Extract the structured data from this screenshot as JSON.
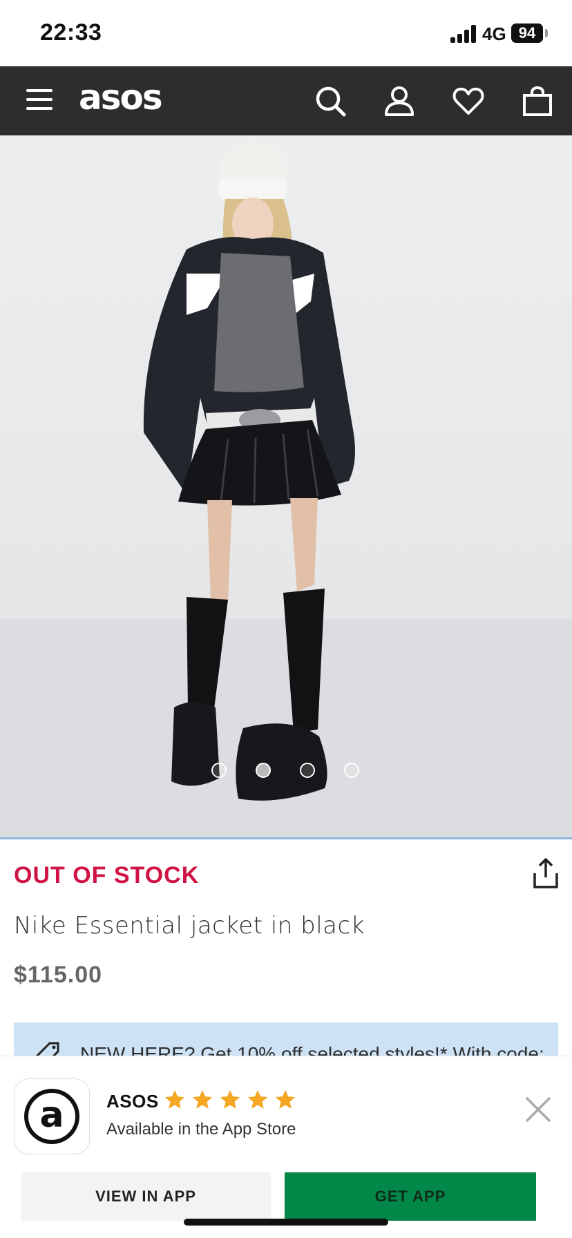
{
  "status_bar": {
    "time": "22:33",
    "network": "4G",
    "battery": "94"
  },
  "header": {
    "logo": "asos",
    "icons": [
      "menu-icon",
      "search-icon",
      "account-icon",
      "heart-icon",
      "bag-icon"
    ]
  },
  "gallery": {
    "image_count": 4,
    "active_index": 1
  },
  "product": {
    "stock_status": "OUT OF STOCK",
    "title": "Nike Essential jacket in black",
    "price": "$115.00"
  },
  "promo": {
    "text": "NEW HERE? Get 10% off selected styles!* With code:"
  },
  "app_banner": {
    "app_name": "ASOS",
    "rating_stars": 5,
    "subtitle": "Available in the App Store",
    "view_button": "VIEW IN APP",
    "get_button": "GET APP"
  },
  "colors": {
    "header_bg": "#2d2d2d",
    "out_of_stock": "#d01345",
    "promo_bg": "#cde2f5",
    "get_app_green": "#018849",
    "star": "#f5a623"
  }
}
